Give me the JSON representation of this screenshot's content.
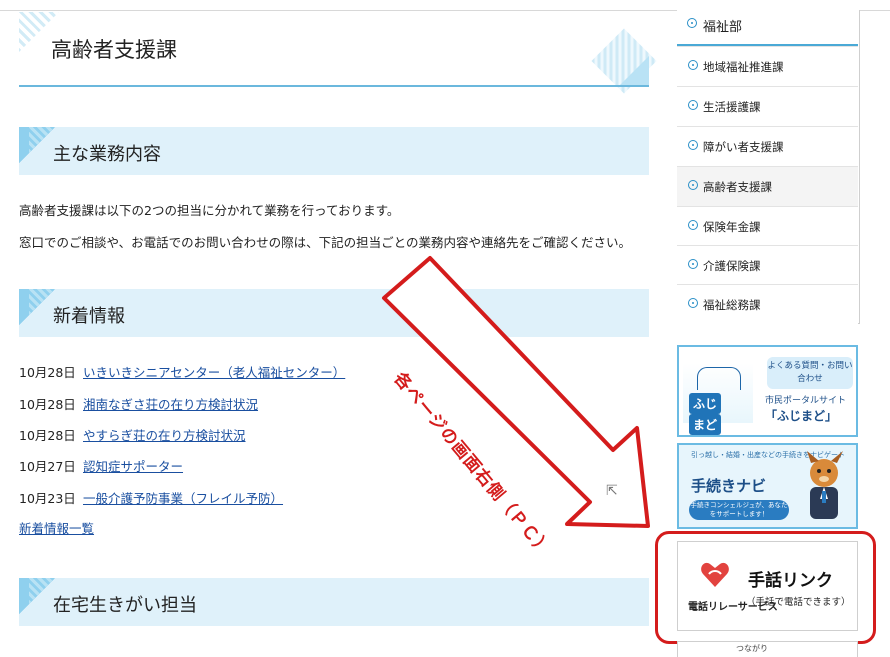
{
  "page": {
    "title": "高齢者支援課"
  },
  "sections": {
    "duties": {
      "heading": "主な業務内容",
      "para1": "高齢者支援課は以下の2つの担当に分かれて業務を行っております。",
      "para2": "窓口でのご相談や、お電話でのお問い合わせの際は、下記の担当ごとの業務内容や連絡先をご確認ください。"
    },
    "news": {
      "heading": "新着情報",
      "items": [
        {
          "date": "10月28日",
          "title": "いきいきシニアセンター（老人福祉センター）"
        },
        {
          "date": "10月28日",
          "title": "湘南なぎさ荘の在り方検討状況"
        },
        {
          "date": "10月28日",
          "title": "やすらぎ荘の在り方検討状況"
        },
        {
          "date": "10月27日",
          "title": "認知症サポーター"
        },
        {
          "date": "10月23日",
          "title": "一般介護予防事業（フレイル予防）"
        }
      ],
      "more_link": "新着情報一覧"
    },
    "home_life": {
      "heading": "在宅生きがい担当"
    }
  },
  "annotation": {
    "text": "各ページの画面右側（ＰＣ）",
    "color": "#d41c1c"
  },
  "sidebar": {
    "head": "福祉部",
    "items": [
      {
        "label": "地域福祉推進課",
        "active": false
      },
      {
        "label": "生活援護課",
        "active": false
      },
      {
        "label": "障がい者支援課",
        "active": false
      },
      {
        "label": "高齢者支援課",
        "active": true
      },
      {
        "label": "保険年金課",
        "active": false
      },
      {
        "label": "介護保険課",
        "active": false
      },
      {
        "label": "福祉総務課",
        "active": false
      }
    ]
  },
  "banners": {
    "fujimado": {
      "logo_left": "ふじ",
      "logo_right": "まど",
      "bubble": "よくある質問・お問い合わせ",
      "sub": "市民ポータルサイト",
      "main": "「ふじまど」"
    },
    "navi": {
      "small": "引っ越し・結婚・出産などの手続きをナビゲート",
      "title": "手続きナビ",
      "pill": "手続きコンシェルジュが、あなたをサポートします！"
    },
    "sign_link": {
      "brand": "電話リレーサービス",
      "title": "手話リンク",
      "sub": "（手話で電話できます）"
    },
    "next": {
      "text": "つながり"
    }
  },
  "colors": {
    "accent": "#4aa9d6",
    "section_bg": "#dff1fa",
    "link": "#1a4fa0",
    "highlight": "#d41c1c"
  }
}
